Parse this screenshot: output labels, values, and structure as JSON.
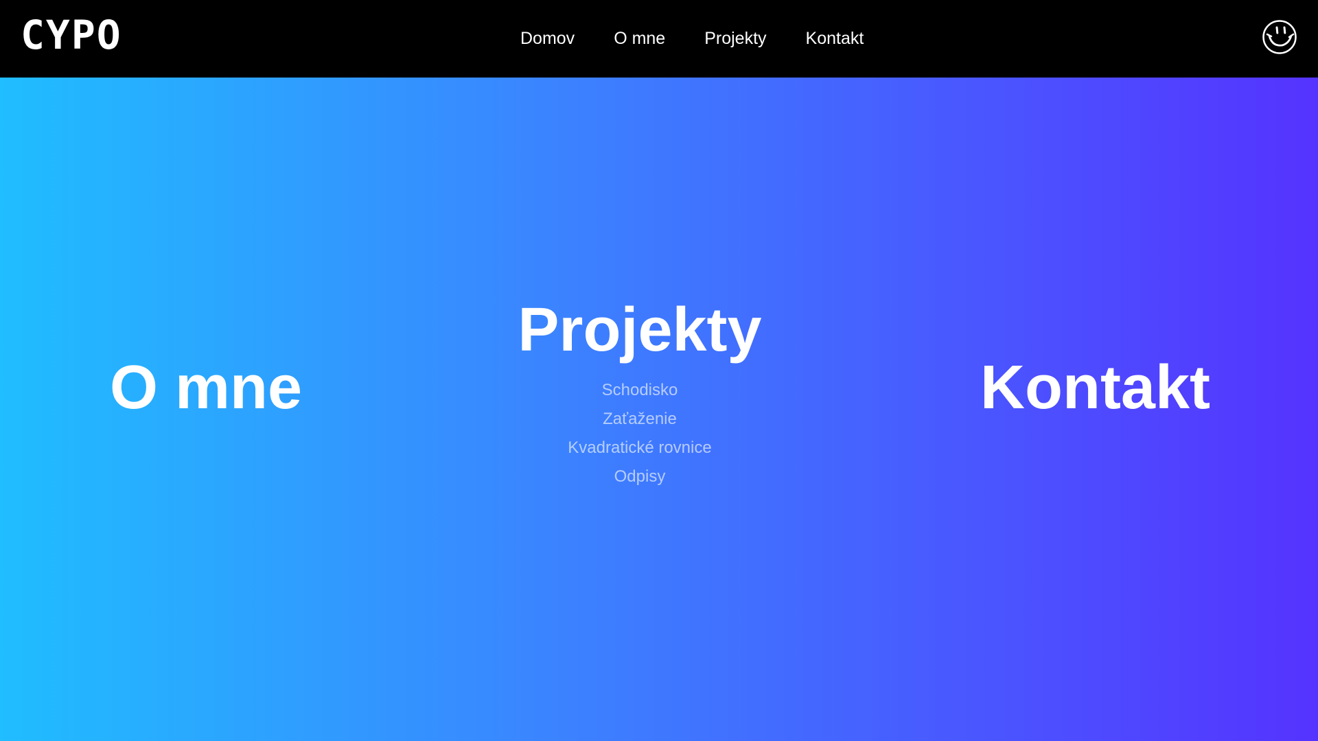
{
  "header": {
    "logo": "CYPO",
    "nav": [
      "Domov",
      "O mne",
      "Projekty",
      "Kontakt"
    ],
    "profile_icon": "smiley-icon"
  },
  "main": {
    "left_title": "O mne",
    "center_title": "Projekty",
    "center_items": [
      "Schodisko",
      "Zaťaženie",
      "Kvadratické rovnice",
      "Odpisy"
    ],
    "right_title": "Kontakt"
  },
  "colors": {
    "navbar_bg": "#000000",
    "gradient_start": "#20bdff",
    "gradient_end": "#5533ff",
    "text": "#ffffff"
  }
}
